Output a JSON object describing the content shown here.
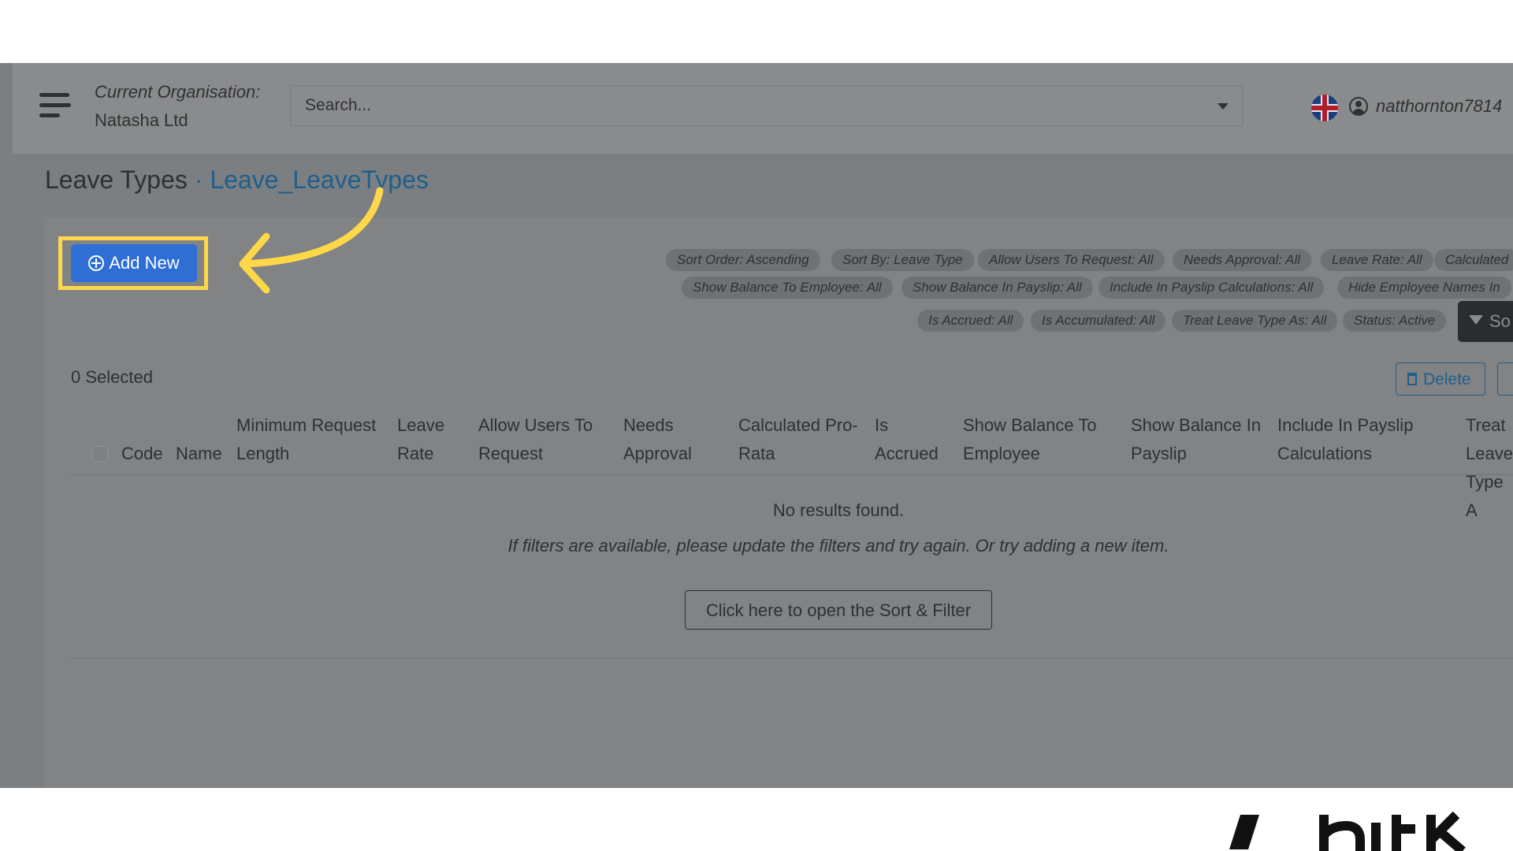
{
  "header": {
    "org_label": "Current Organisation:",
    "org_name": "Natasha Ltd",
    "search_placeholder": "Search...",
    "username": "natthornton7814"
  },
  "page": {
    "title": "Leave Types",
    "separator": " · ",
    "subtitle": "Leave_LeaveTypes"
  },
  "actions": {
    "add_new": "Add New",
    "sort_filter": "So",
    "delete": "Delete"
  },
  "filter_chips": [
    "Sort Order: Ascending",
    "Sort By: Leave Type",
    "Allow Users To Request: All",
    "Needs Approval: All",
    "Leave Rate: All",
    "Calculated",
    "Show Balance To Employee: All",
    "Show Balance In Payslip: All",
    "Include In Payslip Calculations: All",
    "Hide Employee Names In",
    "Is Accrued: All",
    "Is Accumulated: All",
    "Treat Leave Type As: All",
    "Status: Active"
  ],
  "table": {
    "selected_count": "0 Selected",
    "columns": [
      "Code",
      "Name",
      "Minimum Request Length",
      "Leave Rate",
      "Allow Users To Request",
      "Needs Approval",
      "Calculated Pro-Rata",
      "Is Accrued",
      "Show Balance To Employee",
      "Show Balance In Payslip",
      "Include In Payslip Calculations",
      "Treat Leave Type A"
    ],
    "empty_title": "No results found.",
    "empty_hint": "If filters are available, please update the filters and try again. Or try adding a new item.",
    "open_filter_label": "Click here to open the Sort & Filter"
  },
  "colors": {
    "accent": "#2f6ed4",
    "highlight": "#ffd84a",
    "link": "#1f5f8b"
  }
}
